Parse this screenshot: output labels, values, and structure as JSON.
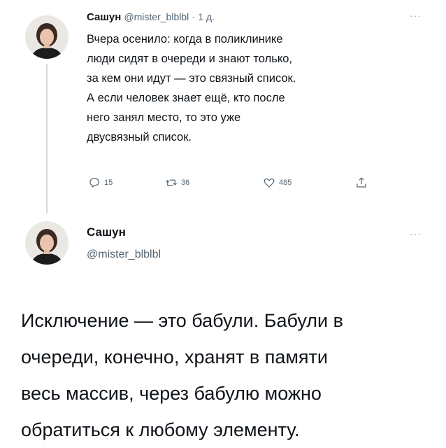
{
  "reply_tweet": {
    "author_name": "Сашун",
    "handle": "@mister_blblbl",
    "separator": "·",
    "time": "1 д.",
    "more_label": "···",
    "text_lines": [
      "Вчера осенило: когда в поликлинике",
      "люди сидят в очереди и знают только,",
      "за кем они идут — это связный список.",
      "А если человек знает ещё, кто после",
      "него занял место, то это уже",
      "двусвязный список."
    ],
    "actions": {
      "reply_count": "15",
      "retweet_count": "36",
      "like_count": "485",
      "reply_icon": "reply-icon",
      "retweet_icon": "retweet-icon",
      "like_icon": "heart-icon",
      "share_icon": "share-icon"
    }
  },
  "main_tweet": {
    "author_name": "Сашун",
    "handle": "@mister_blblbl",
    "more_label": "···",
    "text_lines": [
      "Исключение — это бабули. Бабули в",
      "очереди, конечно, хранят в памяти",
      "весь массив, через бабулю можно",
      "обратиться к любому элементу."
    ]
  },
  "colors": {
    "text": "#0f1419",
    "secondary": "#536471",
    "thread_line": "#cfd9de"
  }
}
